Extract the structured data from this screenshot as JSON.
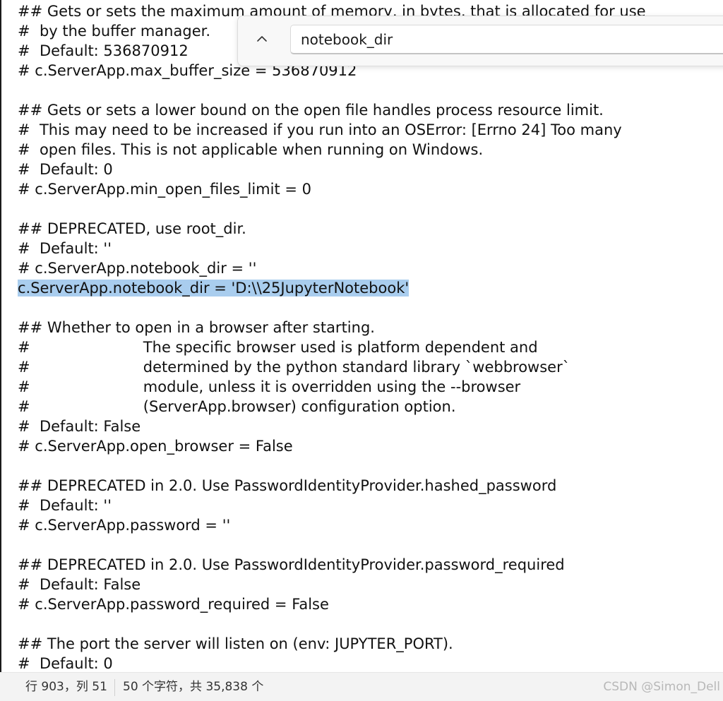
{
  "editor": {
    "lines": [
      {
        "text": "## Gets or sets the maximum amount of memory, in bytes, that is allocated for use",
        "selected": false
      },
      {
        "text": "#  by the buffer manager.",
        "selected": false
      },
      {
        "text": "#  Default: 536870912",
        "selected": false
      },
      {
        "text": "# c.ServerApp.max_buffer_size = 536870912",
        "selected": false
      },
      {
        "text": "",
        "selected": false
      },
      {
        "text": "## Gets or sets a lower bound on the open file handles process resource limit.",
        "selected": false
      },
      {
        "text": "#  This may need to be increased if you run into an OSError: [Errno 24] Too many",
        "selected": false
      },
      {
        "text": "#  open files. This is not applicable when running on Windows.",
        "selected": false
      },
      {
        "text": "#  Default: 0",
        "selected": false
      },
      {
        "text": "# c.ServerApp.min_open_files_limit = 0",
        "selected": false
      },
      {
        "text": "",
        "selected": false
      },
      {
        "text": "## DEPRECATED, use root_dir.",
        "selected": false
      },
      {
        "text": "#  Default: ''",
        "selected": false
      },
      {
        "text": "# c.ServerApp.notebook_dir = ''",
        "selected": false
      },
      {
        "text": "c.ServerApp.notebook_dir = 'D:\\\\25JupyterNotebook'",
        "selected": true
      },
      {
        "text": "",
        "selected": false
      },
      {
        "text": "## Whether to open in a browser after starting.",
        "selected": false
      },
      {
        "text": "#                        The specific browser used is platform dependent and",
        "selected": false
      },
      {
        "text": "#                        determined by the python standard library `webbrowser`",
        "selected": false
      },
      {
        "text": "#                        module, unless it is overridden using the --browser",
        "selected": false
      },
      {
        "text": "#                        (ServerApp.browser) configuration option.",
        "selected": false
      },
      {
        "text": "#  Default: False",
        "selected": false
      },
      {
        "text": "# c.ServerApp.open_browser = False",
        "selected": false
      },
      {
        "text": "",
        "selected": false
      },
      {
        "text": "## DEPRECATED in 2.0. Use PasswordIdentityProvider.hashed_password",
        "selected": false
      },
      {
        "text": "#  Default: ''",
        "selected": false
      },
      {
        "text": "# c.ServerApp.password = ''",
        "selected": false
      },
      {
        "text": "",
        "selected": false
      },
      {
        "text": "## DEPRECATED in 2.0. Use PasswordIdentityProvider.password_required",
        "selected": false
      },
      {
        "text": "#  Default: False",
        "selected": false
      },
      {
        "text": "# c.ServerApp.password_required = False",
        "selected": false
      },
      {
        "text": "",
        "selected": false
      },
      {
        "text": "## The port the server will listen on (env: JUPYTER_PORT).",
        "selected": false
      },
      {
        "text": "#  Default: 0",
        "selected": false
      }
    ]
  },
  "find": {
    "query": "notebook_dir",
    "toggle_icon": "chevron-up-icon"
  },
  "status": {
    "position": "行 903，列 51",
    "count": "50 个字符，共 35,838 个"
  },
  "watermark": "CSDN @Simon_Dell",
  "colors": {
    "selection": "#a9cdee",
    "text": "#111111",
    "status_bg": "#f3f3f3"
  }
}
